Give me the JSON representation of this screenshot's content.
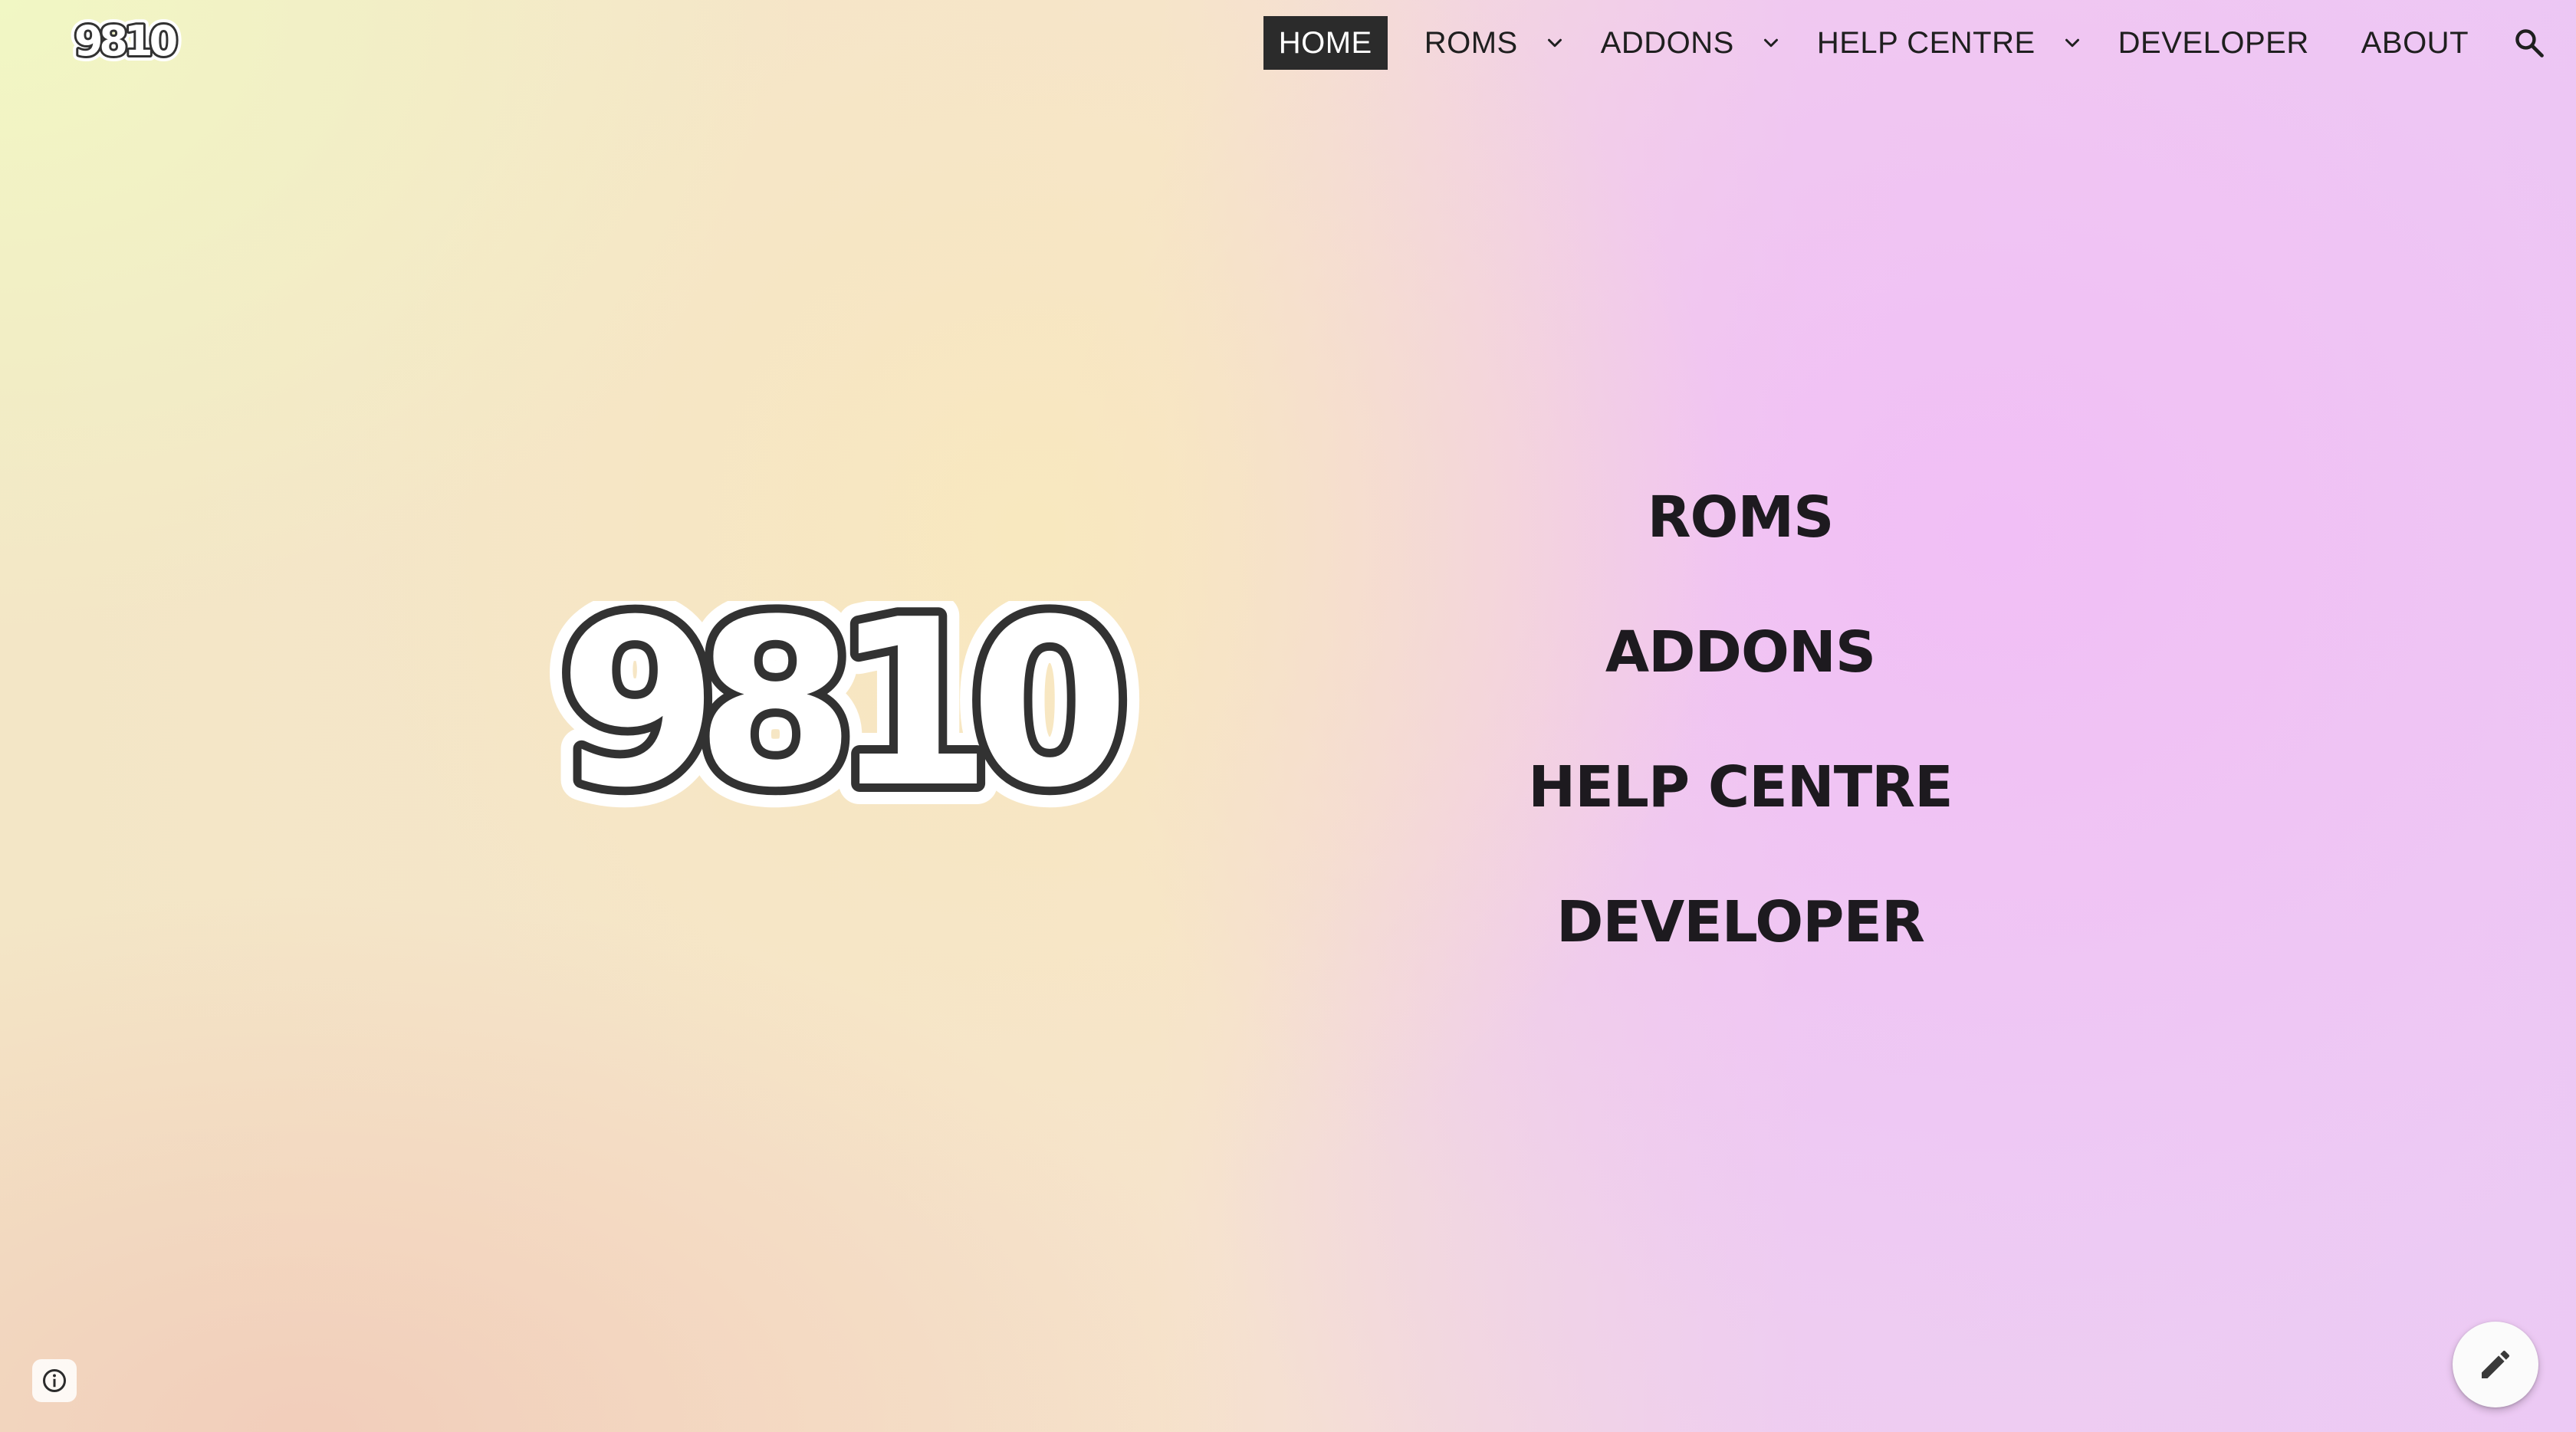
{
  "site": {
    "logo_text": "9810",
    "hero_logo_text": "9810"
  },
  "nav": {
    "items": [
      {
        "label": "HOME",
        "active": true
      },
      {
        "label": "ROMS",
        "has_dropdown": true
      },
      {
        "label": "ADDONS",
        "has_dropdown": true
      },
      {
        "label": "HELP CENTRE",
        "has_dropdown": true
      },
      {
        "label": "DEVELOPER"
      },
      {
        "label": "ABOUT"
      }
    ],
    "search_icon": "search-icon",
    "dropdown_icon": "chevron-down-icon"
  },
  "hero": {
    "links": [
      "ROMS",
      "ADDONS",
      "HELP CENTRE",
      "DEVELOPER"
    ]
  },
  "footer": {
    "info_icon": "info-icon",
    "edit_icon": "pencil-icon"
  },
  "colors": {
    "nav_active_bg": "#2b2b2b",
    "text": "#1f1f1f",
    "logo_fill": "#323232",
    "logo_outline": "#ffffff"
  }
}
